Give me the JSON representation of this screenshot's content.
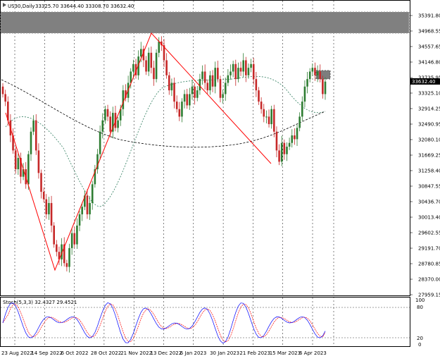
{
  "header": {
    "symbol_label": "US30,Daily",
    "ohlc_label": "33325.70 33644.40 33308.70 33632.40"
  },
  "price_axis": {
    "ticks": [
      "35391.80",
      "34968.55",
      "34557.65",
      "34146.80",
      "33735.95",
      "33325.10",
      "32914.25",
      "32490.95",
      "32080.10",
      "31669.25",
      "31258.40",
      "30847.55",
      "30436.70",
      "30013.40",
      "29602.55",
      "29191.70",
      "28780.85",
      "28370.00",
      "27959.15"
    ],
    "current_price_label": "33632.40"
  },
  "date_axis": {
    "ticks": [
      "23 Aug 2022",
      "14 Sep 2022",
      "6 Oct 2022",
      "28 Oct 2022",
      "21 Nov 2022",
      "13 Dec 2022",
      "6 Jan 2023",
      "30 Jan 2023",
      "21 Feb 2023",
      "15 Mar 2023",
      "6 Apr 2023"
    ]
  },
  "indicator": {
    "label": "Stoch(5,3,3) 32.4327 29.4521",
    "ticks": [
      "100",
      "80",
      "20",
      "0"
    ]
  },
  "colors": {
    "up_candle": "#2e7d32",
    "down_candle": "#c62828",
    "trendline": "#ff0000",
    "zone": "#808080",
    "ma_fast": "#2e7d5e",
    "ma_slow": "#000000",
    "stoch_main": "#0000ff",
    "stoch_signal": "#ff0000"
  },
  "chart_data": {
    "type": "candlestick",
    "symbol": "US30",
    "timeframe": "Daily",
    "last_bar": {
      "open": 33325.7,
      "high": 33644.4,
      "low": 33308.7,
      "close": 33632.4
    },
    "ylim": [
      27959.15,
      35800
    ],
    "zones": [
      {
        "from": 34900,
        "to": 35540
      },
      {
        "from": 33600,
        "to": 33830
      }
    ],
    "closes": [
      33300,
      33100,
      32600,
      32200,
      31800,
      31300,
      31600,
      31100,
      31300,
      30900,
      31700,
      32300,
      32600,
      31800,
      31200,
      30700,
      30500,
      30100,
      30400,
      29800,
      29300,
      29100,
      28900,
      29300,
      28800,
      28700,
      29200,
      29600,
      29300,
      29800,
      30100,
      30300,
      30600,
      30100,
      30400,
      30900,
      31300,
      31700,
      32300,
      32600,
      32900,
      32700,
      32300,
      32800,
      32400,
      32600,
      32900,
      33400,
      33200,
      33600,
      33900,
      34100,
      33800,
      34300,
      34500,
      34200,
      33900,
      34400,
      34000,
      33700,
      34400,
      34700,
      34600,
      34200,
      33800,
      33400,
      33600,
      33100,
      32900,
      32700,
      33100,
      33300,
      33000,
      33300,
      33500,
      33200,
      33400,
      33700,
      33900,
      33600,
      33400,
      33800,
      33500,
      34000,
      33700,
      33200,
      33300,
      33600,
      33800,
      33900,
      34100,
      33700,
      34000,
      33900,
      34200,
      33800,
      34000,
      34100,
      33700,
      33400,
      33100,
      32900,
      32700,
      32700,
      32500,
      32900,
      32300,
      31800,
      31500,
      32000,
      31700,
      31900,
      32000,
      32200,
      32100,
      32400,
      32700,
      33100,
      33500,
      33700,
      33900,
      34000,
      33800,
      33900,
      33700,
      33300,
      33632.4
    ],
    "trendlines": [
      {
        "from": "23 Aug 2022",
        "to": "6 Oct 2022"
      },
      {
        "from": "6 Oct 2022",
        "to": "13 Dec 2022"
      },
      {
        "from": "13 Dec 2022",
        "to": "15 Mar 2023"
      }
    ],
    "stochastic": {
      "k": 32.4327,
      "d": 29.4521,
      "levels": [
        20,
        80
      ]
    }
  }
}
